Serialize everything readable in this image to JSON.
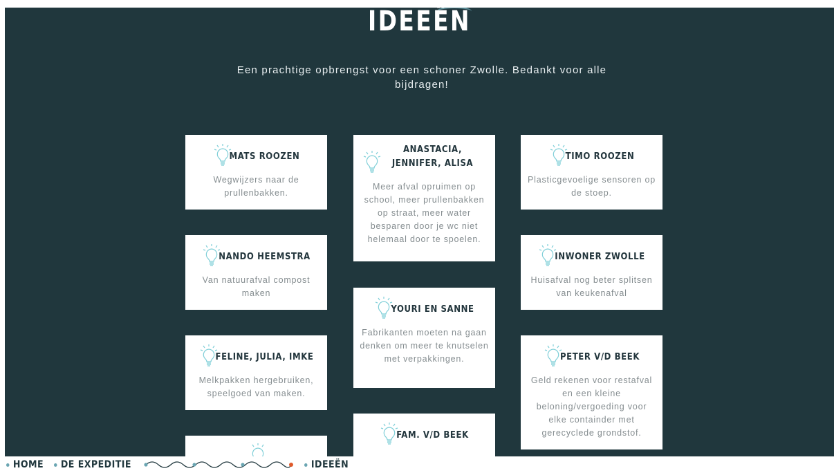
{
  "page": {
    "title": "IDEEËN",
    "intro": "Een prachtige opbrengst voor een schoner Zwolle. Bedankt voor alle bijdragen!"
  },
  "cards": [
    {
      "name": "MATS ROOZEN",
      "text": "Wegwijzers naar de prullenbakken."
    },
    {
      "name": "ANASTACIA, JENNIFER, ALISA",
      "text": "Meer afval opruimen op school, meer prullenbakken op straat, meer water besparen door je wc niet helemaal door te spoelen."
    },
    {
      "name": "TIMO ROOZEN",
      "text": "Plasticgevoelige sensoren op de stoep."
    },
    {
      "name": "NANDO HEEMSTRA",
      "text": "Van natuurafval compost maken"
    },
    {
      "name": "INWONER ZWOLLE",
      "text": "Huisafval nog beter splitsen van keukenafval"
    },
    {
      "name": "YOURI EN SANNE",
      "text": "Fabrikanten moeten na gaan denken om meer te knutselen met verpakkingen."
    },
    {
      "name": "FELINE, JULIA, IMKE",
      "text": "Melkpakken hergebruiken, speelgoed van maken."
    },
    {
      "name": "PETER V/D BEEK",
      "text": "Geld rekenen voor restafval en een kleine beloning/vergoeding voor elke containder met gerecyclede grondstof."
    },
    {
      "name": "FAM. V/D BEEK",
      "text": ""
    }
  ],
  "nav": {
    "items": [
      {
        "label": "HOME"
      },
      {
        "label": "DE EXPEDITIE"
      },
      {
        "label": "IDEEËN"
      }
    ]
  },
  "colors": {
    "background": "#20373d",
    "accent": "#6aa5b2",
    "active": "#e05a2b",
    "card": "#ffffff"
  },
  "icons": {
    "card_icon": "lightbulb-icon",
    "nav_bullet": "dot-icon",
    "nav_progress": "wave-progress-icon"
  }
}
